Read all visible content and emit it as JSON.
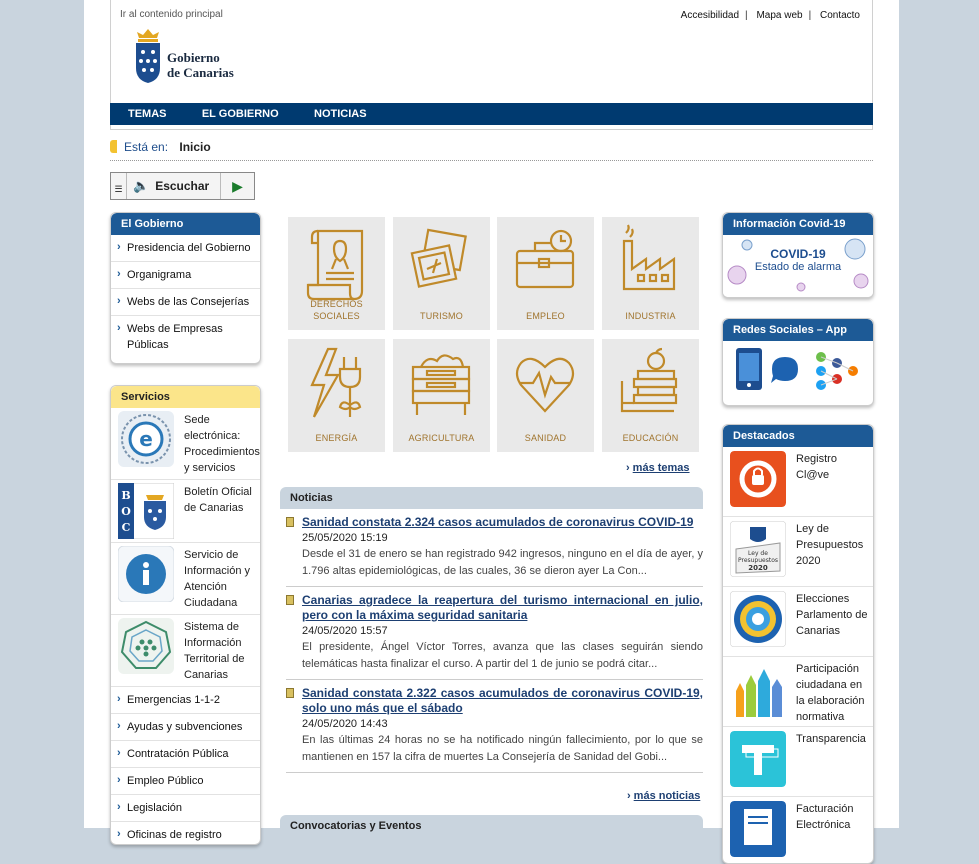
{
  "header": {
    "skip_link": "Ir al contenido principal",
    "toplinks": [
      "Accesibilidad",
      "Mapa web",
      "Contacto"
    ],
    "logo_line1": "Gobierno",
    "logo_line2": "de Canarias",
    "nav": [
      "TEMAS",
      "EL GOBIERNO",
      "NOTICIAS"
    ]
  },
  "breadcrumb": {
    "label": "Está en:",
    "current": "Inicio"
  },
  "listen": {
    "label": "Escuchar"
  },
  "gobierno_box": {
    "title": "El Gobierno",
    "items": [
      "Presidencia del Gobierno",
      "Organigrama",
      "Webs de las Consejerías",
      "Webs de Empresas Públicas"
    ]
  },
  "servicios_box": {
    "title": "Servicios",
    "featured": [
      {
        "label": "Sede electrónica: Procedimientos y servicios",
        "icon": "e-sede-icon"
      },
      {
        "label": "Boletín Oficial de Canarias",
        "icon": "boc-icon"
      },
      {
        "label": "Servicio de Información y Atención Ciudadana",
        "icon": "info-icon"
      },
      {
        "label": "Sistema de Información Territorial de Canarias",
        "icon": "map-icon"
      }
    ],
    "items": [
      "Emergencias 1-1-2",
      "Ayudas y subvenciones",
      "Contratación Pública",
      "Empleo Público",
      "Legislación",
      "Oficinas de registro"
    ]
  },
  "tiles": [
    {
      "label": "DERECHOS SOCIALES",
      "icon": "scroll-ribbon-icon"
    },
    {
      "label": "TURISMO",
      "icon": "photos-plane-icon"
    },
    {
      "label": "EMPLEO",
      "icon": "briefcase-clock-icon"
    },
    {
      "label": "INDUSTRIA",
      "icon": "factory-icon"
    },
    {
      "label": "ENERGÍA",
      "icon": "bolt-plug-icon"
    },
    {
      "label": "AGRICULTURA",
      "icon": "crate-icon"
    },
    {
      "label": "SANIDAD",
      "icon": "heart-pulse-icon"
    },
    {
      "label": "EDUCACIÓN",
      "icon": "books-apple-icon"
    }
  ],
  "mas_temas": "más temas",
  "news": {
    "title": "Noticias",
    "items": [
      {
        "title": "Sanidad constata 2.324 casos acumulados de coronavirus COVID-19",
        "date": "25/05/2020 15:19",
        "text": "Desde el 31 de enero se han registrado 942 ingresos, ninguno en el día de ayer, y 1.796 altas epidemiológicas, de las cuales, 36 se dieron ayer La Con..."
      },
      {
        "title": "Canarias agradece la reapertura del turismo internacional en julio, pero con la máxima seguridad sanitaria",
        "date": "24/05/2020 15:57",
        "text": "El presidente, Ángel Víctor Torres, avanza que las clases seguirán siendo telemáticas hasta finalizar el curso. A partir del 1 de junio se podrá citar..."
      },
      {
        "title": "Sanidad constata 2.322 casos acumulados de coronavirus COVID-19, solo uno más que el sábado",
        "date": "24/05/2020 14:43",
        "text": "En las últimas 24 horas no se ha notificado ningún fallecimiento, por lo que se mantienen en 157 la cifra de muertes La Consejería de Sanidad del Gobi..."
      }
    ],
    "more": "más noticias"
  },
  "convocatorias": {
    "title": "Convocatorias y Eventos"
  },
  "covid_box": {
    "title": "Información Covid-19",
    "banner_line1": "COVID-19",
    "banner_line2": "Estado de alarma"
  },
  "redes_box": {
    "title": "Redes Sociales – App"
  },
  "destacados": {
    "title": "Destacados",
    "items": [
      {
        "label": "Registro Cl@ve",
        "icon": "clave-icon"
      },
      {
        "label": "Ley de Presupuestos 2020",
        "icon": "presupuestos-icon",
        "caption1": "Ley de",
        "caption2": "Presupuestos",
        "caption3": "2020"
      },
      {
        "label": "Elecciones Parlamento de Canarias",
        "icon": "elecciones-icon"
      },
      {
        "label": "Participación ciudadana en la elaboración normativa",
        "icon": "hands-icon"
      },
      {
        "label": "Transparencia",
        "icon": "transparencia-icon"
      },
      {
        "label": "Facturación Electrónica",
        "icon": "factura-icon"
      }
    ]
  }
}
